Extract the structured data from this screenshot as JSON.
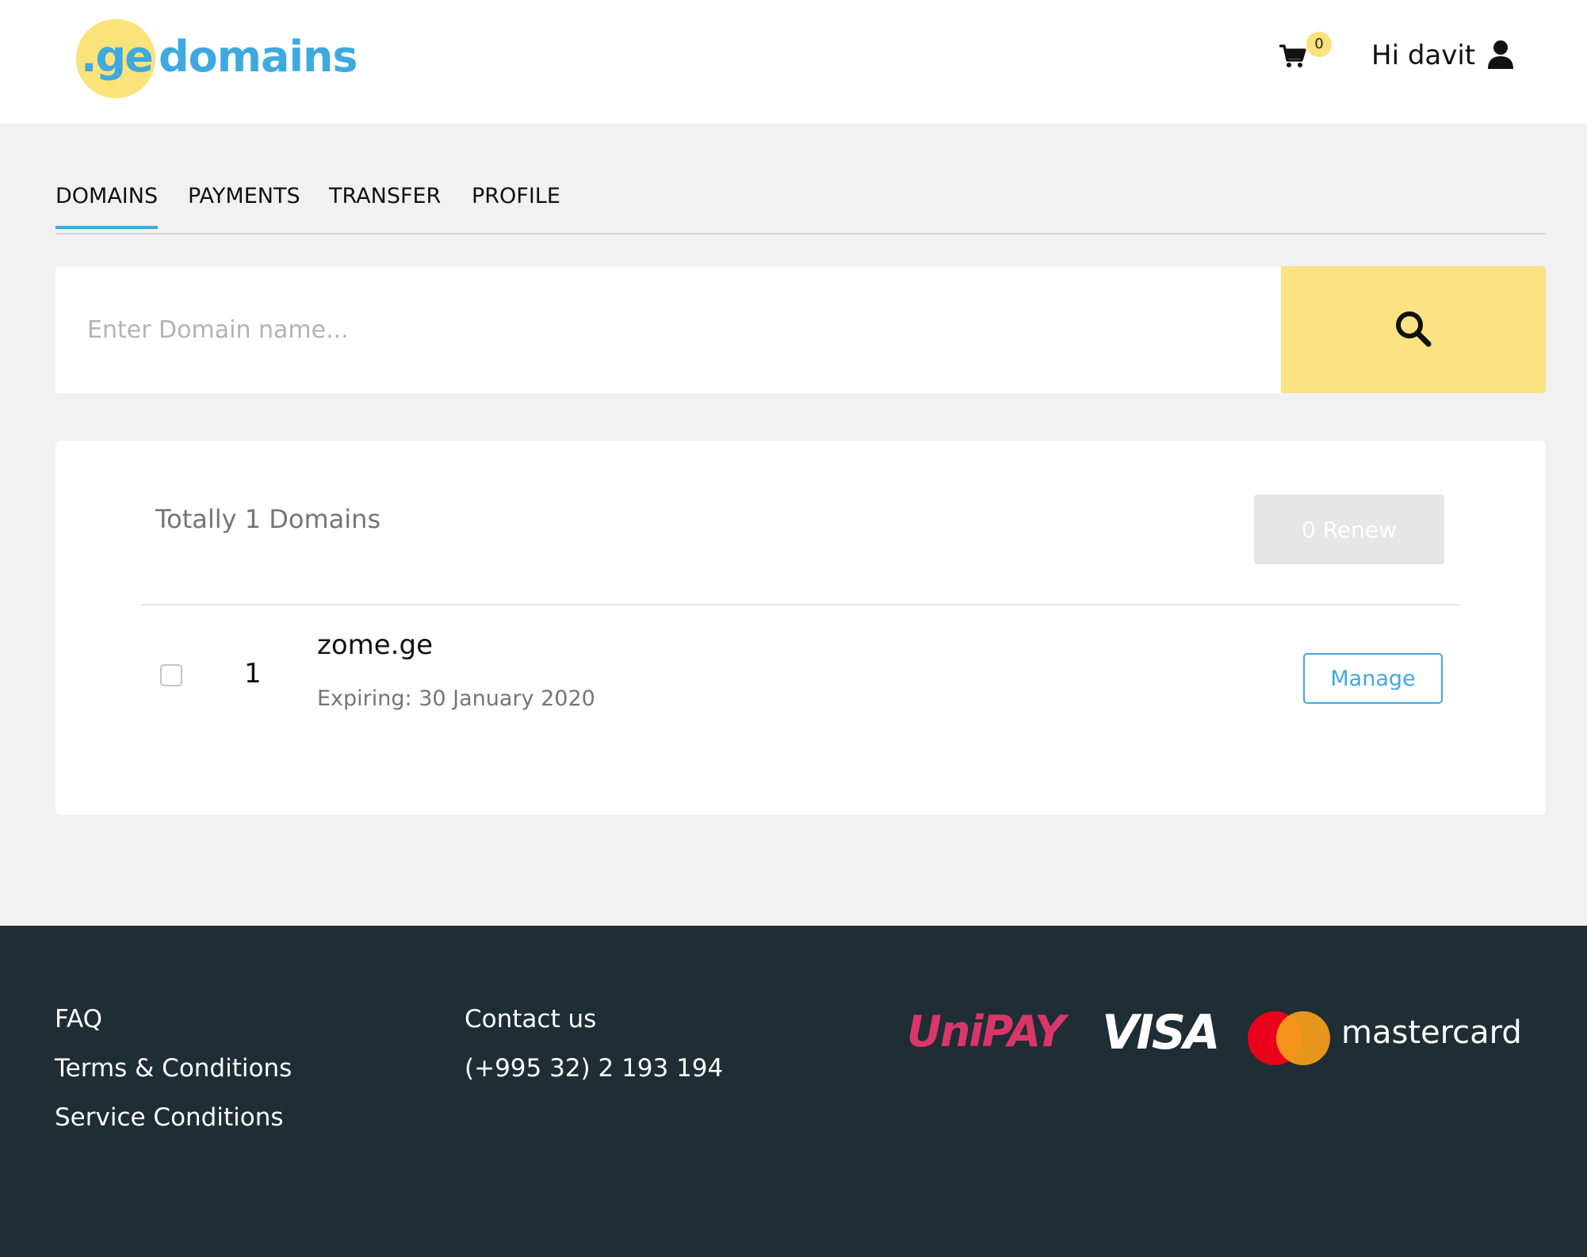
{
  "header": {
    "logo": {
      "prefix": ".ge",
      "name": "domains"
    },
    "cart": {
      "count": "0",
      "icon": "cart-icon"
    },
    "user": {
      "greeting": "Hi davit",
      "icon": "user-icon"
    }
  },
  "tabs": [
    {
      "label": "DOMAINS",
      "active": true
    },
    {
      "label": "PAYMENTS",
      "active": false
    },
    {
      "label": "TRANSFER",
      "active": false
    },
    {
      "label": "PROFILE",
      "active": false
    }
  ],
  "search": {
    "placeholder": "Enter Domain name...",
    "value": "",
    "button_icon": "search-icon"
  },
  "domains": {
    "total_text": "Totally 1 Domains",
    "renew_label": "0 Renew",
    "rows": [
      {
        "index": "1",
        "name": "zome.ge",
        "expiring": "Expiring: 30 January 2020",
        "checked": false,
        "manage_label": "Manage"
      }
    ]
  },
  "footer": {
    "links": [
      "FAQ",
      "Terms & Conditions",
      "Service Conditions"
    ],
    "contact_label": "Contact us",
    "phone": "(+995 32) 2 193 194",
    "payment_logos": {
      "unipay": "UniPAY",
      "visa": "VISA",
      "mastercard": "mastercard"
    }
  },
  "colors": {
    "accent_blue": "#3ea9e0",
    "accent_yellow": "#fbe283",
    "footer_bg": "#1f2d35",
    "page_bg": "#f1f1f1",
    "unipay_pink": "#d9366a"
  }
}
